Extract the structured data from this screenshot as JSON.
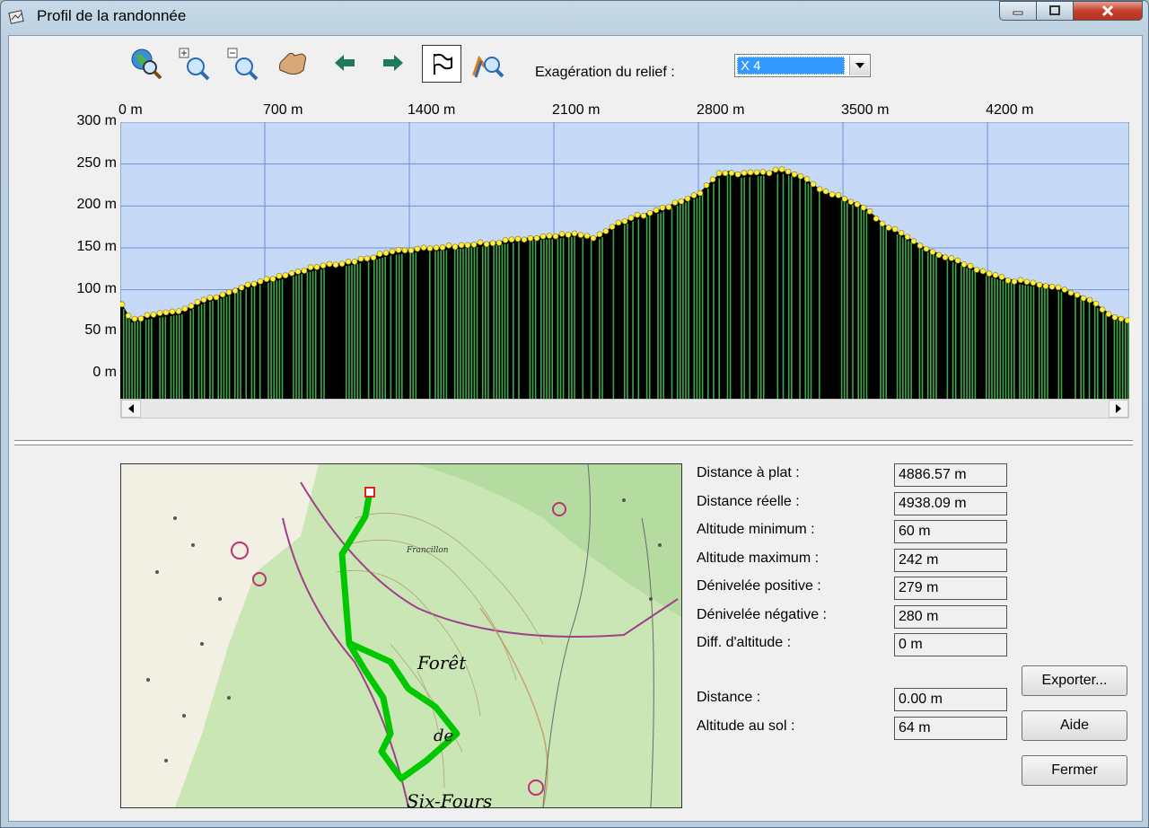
{
  "window": {
    "title": "Profil de la randonnée"
  },
  "toolbar": {
    "icons": [
      "zoom-globe-icon",
      "zoom-in-icon",
      "zoom-out-icon",
      "pan-hand-icon",
      "arrow-left-icon",
      "arrow-right-icon",
      "flag-icon",
      "profile-search-icon"
    ],
    "relief_label": "Exagération du relief :",
    "relief_value": "X 4"
  },
  "chart_data": {
    "type": "area",
    "x_ticks": [
      "0 m",
      "700 m",
      "1400 m",
      "2100 m",
      "2800 m",
      "3500 m",
      "4200 m"
    ],
    "y_ticks": [
      "300 m",
      "250 m",
      "200 m",
      "150 m",
      "100 m",
      "50 m",
      "0 m"
    ],
    "xlim": [
      0,
      4886.57
    ],
    "ylim": [
      -30,
      300
    ],
    "x": [
      0,
      50,
      150,
      300,
      400,
      500,
      600,
      700,
      800,
      900,
      1000,
      1100,
      1200,
      1300,
      1400,
      1500,
      1600,
      1700,
      1800,
      1900,
      2000,
      2100,
      2200,
      2300,
      2400,
      2500,
      2600,
      2700,
      2800,
      2900,
      2950,
      3000,
      3100,
      3200,
      3300,
      3400,
      3500,
      3600,
      3700,
      3800,
      3900,
      4000,
      4100,
      4200,
      4300,
      4400,
      4500,
      4600,
      4700,
      4800,
      4886
    ],
    "y": [
      87,
      65,
      70,
      75,
      88,
      95,
      105,
      112,
      118,
      125,
      130,
      133,
      138,
      145,
      148,
      150,
      152,
      155,
      157,
      160,
      163,
      165,
      168,
      162,
      178,
      188,
      195,
      205,
      215,
      238,
      242,
      238,
      240,
      243,
      236,
      218,
      210,
      200,
      178,
      165,
      150,
      140,
      130,
      120,
      113,
      109,
      106,
      98,
      88,
      70,
      64
    ],
    "background": "#c6daf7",
    "grid": true,
    "fill_colors": [
      "#000000",
      "#3fa64a"
    ],
    "marker_color": "#ffef40"
  },
  "stats": [
    {
      "label": "Distance à plat :",
      "value": "4886.57 m"
    },
    {
      "label": "Distance réelle :",
      "value": "4938.09 m"
    },
    {
      "label": "Altitude minimum :",
      "value": "60 m"
    },
    {
      "label": "Altitude maximum :",
      "value": "242 m"
    },
    {
      "label": "Dénivelée positive :",
      "value": "279 m"
    },
    {
      "label": "Dénivelée négative :",
      "value": "280 m"
    },
    {
      "label": "Diff. d'altitude :",
      "value": "0 m"
    }
  ],
  "cursor": [
    {
      "label": "Distance :",
      "value": "0.00 m"
    },
    {
      "label": "Altitude au sol :",
      "value": "64 m"
    }
  ],
  "buttons": {
    "export": "Exporter...",
    "help": "Aide",
    "close": "Fermer"
  },
  "map": {
    "labels": [
      "Forêt",
      "de",
      "Six-Fours",
      "Francillon"
    ]
  }
}
